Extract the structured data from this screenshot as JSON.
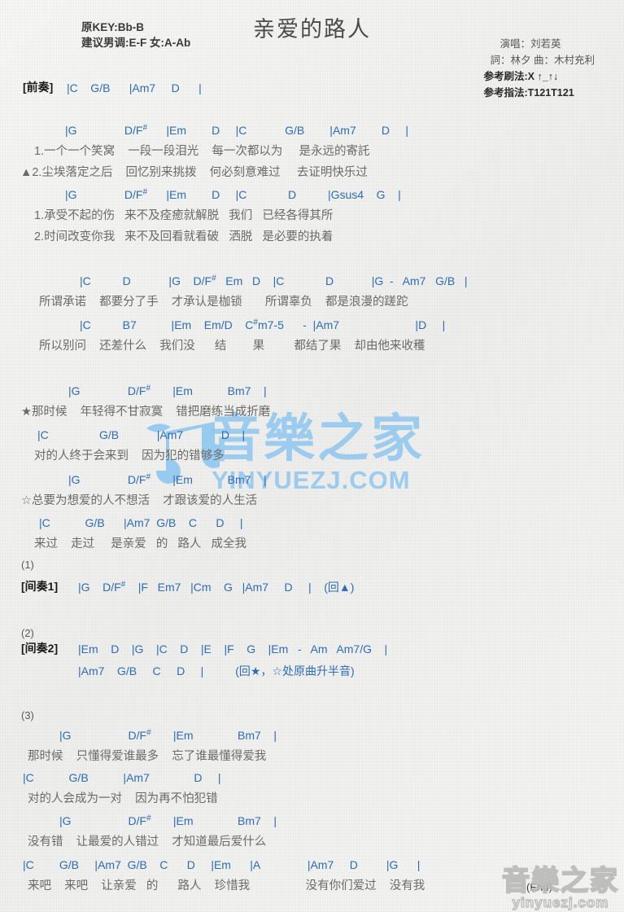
{
  "header": {
    "key_info_line1": "原KEY:Bb-B",
    "key_info_line2": "建议男调:E-F 女:A-Ab",
    "title": "亲爱的路人",
    "singer": "演唱：刘若英",
    "writers": "詞：林夕   曲：木村充利",
    "strum_pattern": "参考刷法:X ↑_↑↓",
    "finger_pattern": "参考指法:T121T121"
  },
  "intro": {
    "tag": "[前奏]",
    "chords": "|C    G/B      |Am7     D      |"
  },
  "verse1": {
    "line1_chords": "|G               D/F#      |Em        D     |C            G/B        |Am7        D     |",
    "line1_lyric_a": "1.一个一个笑窝    一段一段泪光    每一次都以为     是永远的寄託",
    "line1_lyric_b": "▲2.尘埃落定之后    回忆别来挑拨    何必刻意难过     去证明快乐过",
    "line2_chords": "|G               D/F#      |Em        D     |C             D          |Gsus4    G    |",
    "line2_lyric_a": "1.承受不起的伤   来不及痊癒就解脱   我们   已经各得其所",
    "line2_lyric_b": "2.时间改变你我   来不及回看就看破   洒脱   是必要的执着"
  },
  "prechorus": {
    "line1_chords": "|C          D            |G    D/F#   Em   D    |C             D            |G  -   Am7   G/B   |",
    "line1_lyric": "所谓承诺    都要分了手    才承认是枷锁       所谓辜负    都是浪漫的蹉跎",
    "line2_chords": "|C          B7           |Em    Em/D    C#m7-5      -  |Am7                        |D     |",
    "line2_lyric": "所以别问    还差什么    我们没      结        果         都结了果    却由他来收穫"
  },
  "chorus": {
    "line1_chords": "|G               D/F#       |Em           Bm7    |",
    "line1_lyric": "★那时候    年轻得不甘寂寞    错把磨练当成折磨",
    "line2_chords": "|C                G/B            |Am7            D    |",
    "line2_lyric": "对的人终于会来到    因为犯的错够多",
    "line3_chords": "|G               D/F#       |Em           Bm7    |",
    "line3_lyric": "☆总要为想爱的人不想活    才跟该爱的人生活",
    "line4_chords": "|C           G/B      |Am7  G/B    C      D     |",
    "line4_lyric": "来过    走过     是亲爱   的   路人   成全我"
  },
  "interlude1": {
    "number": "(1)",
    "tag": "[间奏1]",
    "chords": "|G    D/F#    |F   Em7   |Cm    G   |Am7     D     |    (回▲)"
  },
  "interlude2": {
    "number": "(2)",
    "tag": "[间奏2]",
    "line1": "|Em    D    |G    |C    D    |E    |F    G    |Em   -   Am   Am7/G    |",
    "line2": "|Am7    G/B     C     D     |          (回★，☆处原曲升半音)"
  },
  "final": {
    "number": "(3)",
    "line1_chords": "|G                  D/F#       |Em              Bm7    |",
    "line1_lyric": "那时候    只懂得爱谁最多    忘了谁最懂得爱我",
    "line2_chords": "|C           G/B           |Am7              D     |",
    "line2_lyric": "对的人会成为一对    因为再不怕犯错",
    "line3_chords": "|G                  D/F#       |Em              Bm7    |",
    "line3_lyric": "没有错    让最爱的人错过    才知道最后爱什么",
    "line4_chords": "|C        G/B     |Am7  G/B    C      D     |Em      |A               |Am7     D         |G      |",
    "line4_lyric": "来吧    来吧    让亲爱   的      路人    珍惜我                 没有你们爱过    没有我",
    "end_marker": "(End)"
  },
  "watermark": {
    "center_cn": "音樂之家",
    "center_en": "YINYUEZJ.COM",
    "bottom_cn": "音樂之家",
    "bottom_en": "yinyuezj.com"
  },
  "colors": {
    "chord": "#2d6cb6",
    "lyric": "#6a6a6a",
    "title": "#4a4a4a",
    "watermark": "#8ec6ef"
  }
}
